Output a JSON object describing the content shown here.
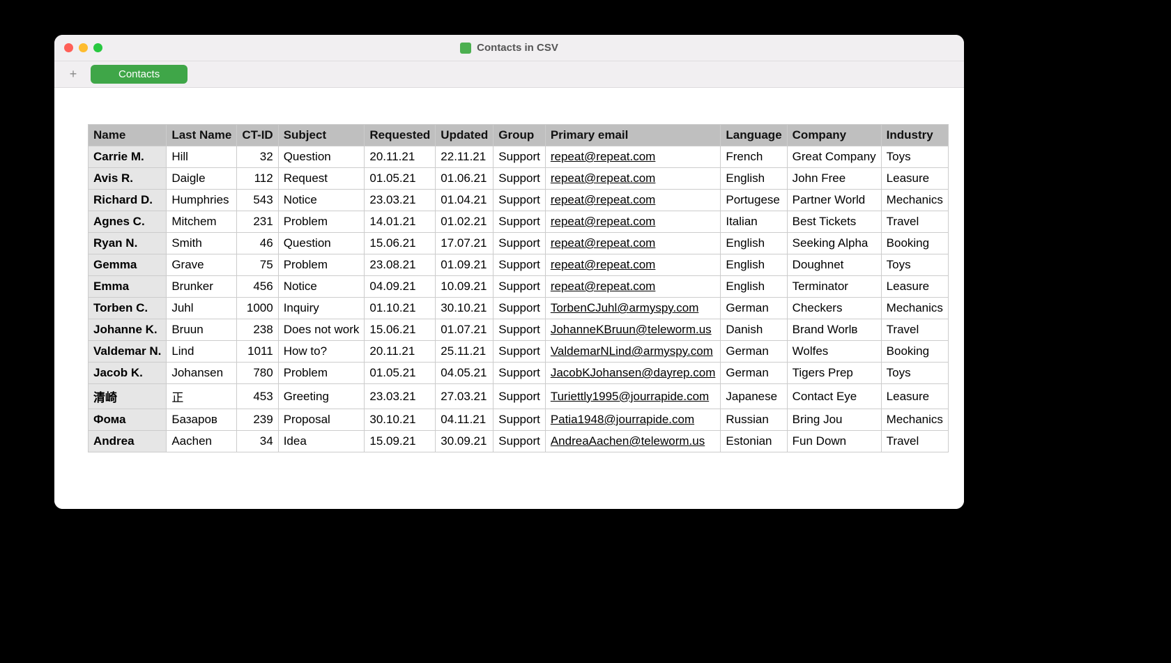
{
  "window": {
    "title": "Contacts in CSV"
  },
  "tabbar": {
    "add_label": "+",
    "sheet_label": "Contacts"
  },
  "table": {
    "headers": [
      "Name",
      "Last Name",
      "CT-ID",
      "Subject",
      "Requested",
      "Updated",
      "Group",
      "Primary email",
      "Language",
      "Company",
      "Industry"
    ],
    "rows": [
      {
        "name": "Carrie M.",
        "last": "Hill",
        "ctid": "32",
        "subject": "Question",
        "requested": "20.11.21",
        "updated": "22.11.21",
        "group": "Support",
        "email": "repeat@repeat.com",
        "language": "French",
        "company": "Great Company",
        "industry": "Toys"
      },
      {
        "name": "Avis R.",
        "last": "Daigle",
        "ctid": "112",
        "subject": "Request",
        "requested": "01.05.21",
        "updated": "01.06.21",
        "group": "Support",
        "email": "repeat@repeat.com",
        "language": "English",
        "company": "John Free",
        "industry": "Leasure"
      },
      {
        "name": "Richard D.",
        "last": "Humphries",
        "ctid": "543",
        "subject": "Notice",
        "requested": "23.03.21",
        "updated": "01.04.21",
        "group": "Support",
        "email": "repeat@repeat.com",
        "language": "Portugese",
        "company": "Partner World",
        "industry": "Mechanics"
      },
      {
        "name": "Agnes C.",
        "last": "Mitchem",
        "ctid": "231",
        "subject": "Problem",
        "requested": "14.01.21",
        "updated": "01.02.21",
        "group": "Support",
        "email": "repeat@repeat.com",
        "language": "Italian",
        "company": "Best Tickets",
        "industry": "Travel"
      },
      {
        "name": "Ryan N.",
        "last": "Smith",
        "ctid": "46",
        "subject": "Question",
        "requested": "15.06.21",
        "updated": "17.07.21",
        "group": "Support",
        "email": "repeat@repeat.com",
        "language": "English",
        "company": "Seeking Alpha",
        "industry": "Booking"
      },
      {
        "name": "Gemma",
        "last": "Grave",
        "ctid": "75",
        "subject": "Problem",
        "requested": "23.08.21",
        "updated": "01.09.21",
        "group": "Support",
        "email": "repeat@repeat.com",
        "language": "English",
        "company": "Doughnet",
        "industry": "Toys"
      },
      {
        "name": "Emma",
        "last": "Brunker",
        "ctid": "456",
        "subject": "Notice",
        "requested": "04.09.21",
        "updated": "10.09.21",
        "group": "Support",
        "email": "repeat@repeat.com",
        "language": "English",
        "company": "Terminator",
        "industry": "Leasure"
      },
      {
        "name": "Torben C.",
        "last": "Juhl",
        "ctid": "1000",
        "subject": "Inquiry",
        "requested": "01.10.21",
        "updated": "30.10.21",
        "group": "Support",
        "email": "TorbenCJuhl@armyspy.com",
        "language": "German",
        "company": "Checkers",
        "industry": "Mechanics"
      },
      {
        "name": "Johanne K.",
        "last": "Bruun",
        "ctid": "238",
        "subject": "Does not work",
        "requested": "15.06.21",
        "updated": "01.07.21",
        "group": "Support",
        "email": "JohanneKBruun@teleworm.us",
        "language": "Danish",
        "company": "Brand Worlв",
        "industry": "Travel"
      },
      {
        "name": "Valdemar N.",
        "last": "Lind",
        "ctid": "1011",
        "subject": "How to?",
        "requested": "20.11.21",
        "updated": "25.11.21",
        "group": "Support",
        "email": "ValdemarNLind@armyspy.com",
        "language": "German",
        "company": "Wolfes",
        "industry": "Booking"
      },
      {
        "name": "Jacob K.",
        "last": "Johansen",
        "ctid": "780",
        "subject": "Problem",
        "requested": "01.05.21",
        "updated": "04.05.21",
        "group": "Support",
        "email": "JacobKJohansen@dayrep.com",
        "language": "German",
        "company": "Tigers Prep",
        "industry": "Toys"
      },
      {
        "name": "清崎",
        "last": "正",
        "ctid": "453",
        "subject": "Greeting",
        "requested": "23.03.21",
        "updated": "27.03.21",
        "group": "Support",
        "email": "Turiettly1995@jourrapide.com",
        "language": "Japanese",
        "company": "Contact Eye",
        "industry": "Leasure"
      },
      {
        "name": "Фома",
        "last": "Базаров",
        "ctid": "239",
        "subject": "Proposal",
        "requested": "30.10.21",
        "updated": "04.11.21",
        "group": "Support",
        "email": "Patia1948@jourrapide.com",
        "language": "Russian",
        "company": "Bring Jou",
        "industry": "Mechanics"
      },
      {
        "name": "Andrea",
        "last": "Aachen",
        "ctid": "34",
        "subject": "Idea",
        "requested": "15.09.21",
        "updated": "30.09.21",
        "group": "Support",
        "email": "AndreaAachen@teleworm.us",
        "language": "Estonian",
        "company": "Fun Down",
        "industry": "Travel"
      }
    ]
  }
}
